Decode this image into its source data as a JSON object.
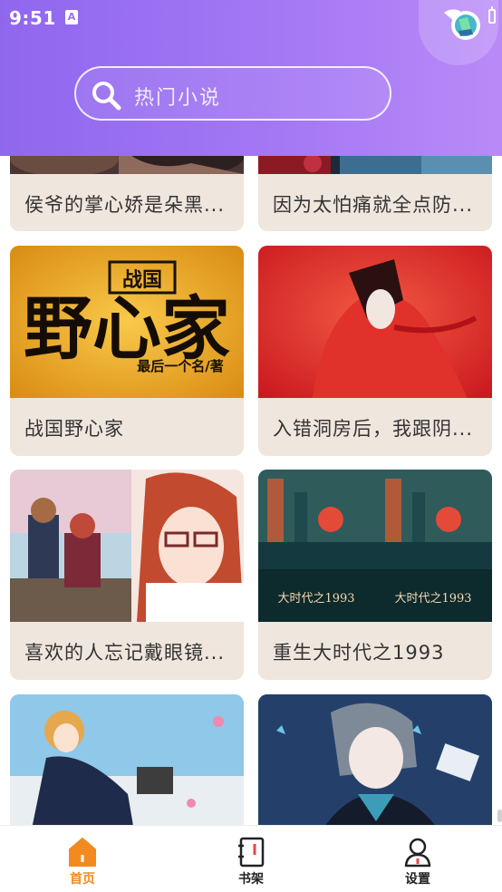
{
  "status_bar": {
    "time": "9:51",
    "notification_badge": "A"
  },
  "search": {
    "placeholder": "热门小说"
  },
  "books": [
    {
      "title": "侯爷的掌心娇是朵黑..."
    },
    {
      "title": "因为太怕痛就全点防..."
    },
    {
      "title": "战国野心家",
      "cover_text": {
        "top": "战国",
        "main": "野心家",
        "author": "最后一个名/著"
      }
    },
    {
      "title": "入错洞房后，我跟阴..."
    },
    {
      "title": "喜欢的人忘记戴眼镜..."
    },
    {
      "title": "重生大时代之1993",
      "cover_text": "大时代之1993"
    },
    {
      "title": ""
    },
    {
      "title": ""
    }
  ],
  "bottom_nav": {
    "items": [
      {
        "label": "首页",
        "icon": "home-icon",
        "active": true
      },
      {
        "label": "书架",
        "icon": "bookshelf-icon",
        "active": false
      },
      {
        "label": "设置",
        "icon": "settings-person-icon",
        "active": false
      }
    ]
  },
  "colors": {
    "header_start": "#8f67ee",
    "header_end": "#b98af7",
    "card_bg": "#efe6dd",
    "active_tab": "#f38a1f"
  }
}
